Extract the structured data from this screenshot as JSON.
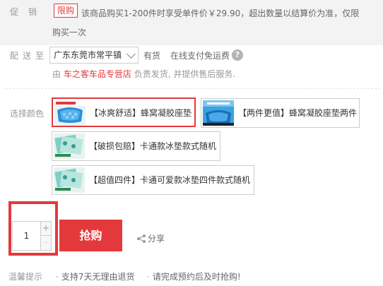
{
  "promo": {
    "label": "促销",
    "tag": "限购",
    "text_line1": "该商品购买1-200件时享受单件价￥29.90，超出数量以结算价为准，仅限",
    "text_line2": "购买一次"
  },
  "delivery": {
    "label": "配送至",
    "address": "广东东莞市常平镇",
    "stock": "有货",
    "shipping": "在线支付免运费",
    "help_icon": "question-circle-icon"
  },
  "seller": {
    "prefix": "由",
    "shop": "车之客车品专营店",
    "suffix": "负责发货, 并提供售后服务."
  },
  "color": {
    "label": "选择颜色",
    "options": [
      {
        "label": "【冰爽舒适】蜂窝凝胶座垫",
        "selected": true
      },
      {
        "label": "【两件更值】蜂窝凝胶座垫两件",
        "selected": false
      },
      {
        "label": "【破损包赔】卡通款冰垫款式随机",
        "selected": false
      },
      {
        "label": "【超值四件】卡通可爱款冰垫四件款式随机",
        "selected": false
      }
    ]
  },
  "purchase": {
    "quantity": "1",
    "plus": "+",
    "minus": "-",
    "buy_label": "抢购",
    "share_label": "分享"
  },
  "tips": {
    "label": "温馨提示",
    "items": [
      "支持7天无理由退货",
      "请完成预约后及时抢购!"
    ]
  },
  "colors": {
    "accent": "#e4393c",
    "muted": "#999999",
    "promo_bg": "#f3f3f3"
  }
}
